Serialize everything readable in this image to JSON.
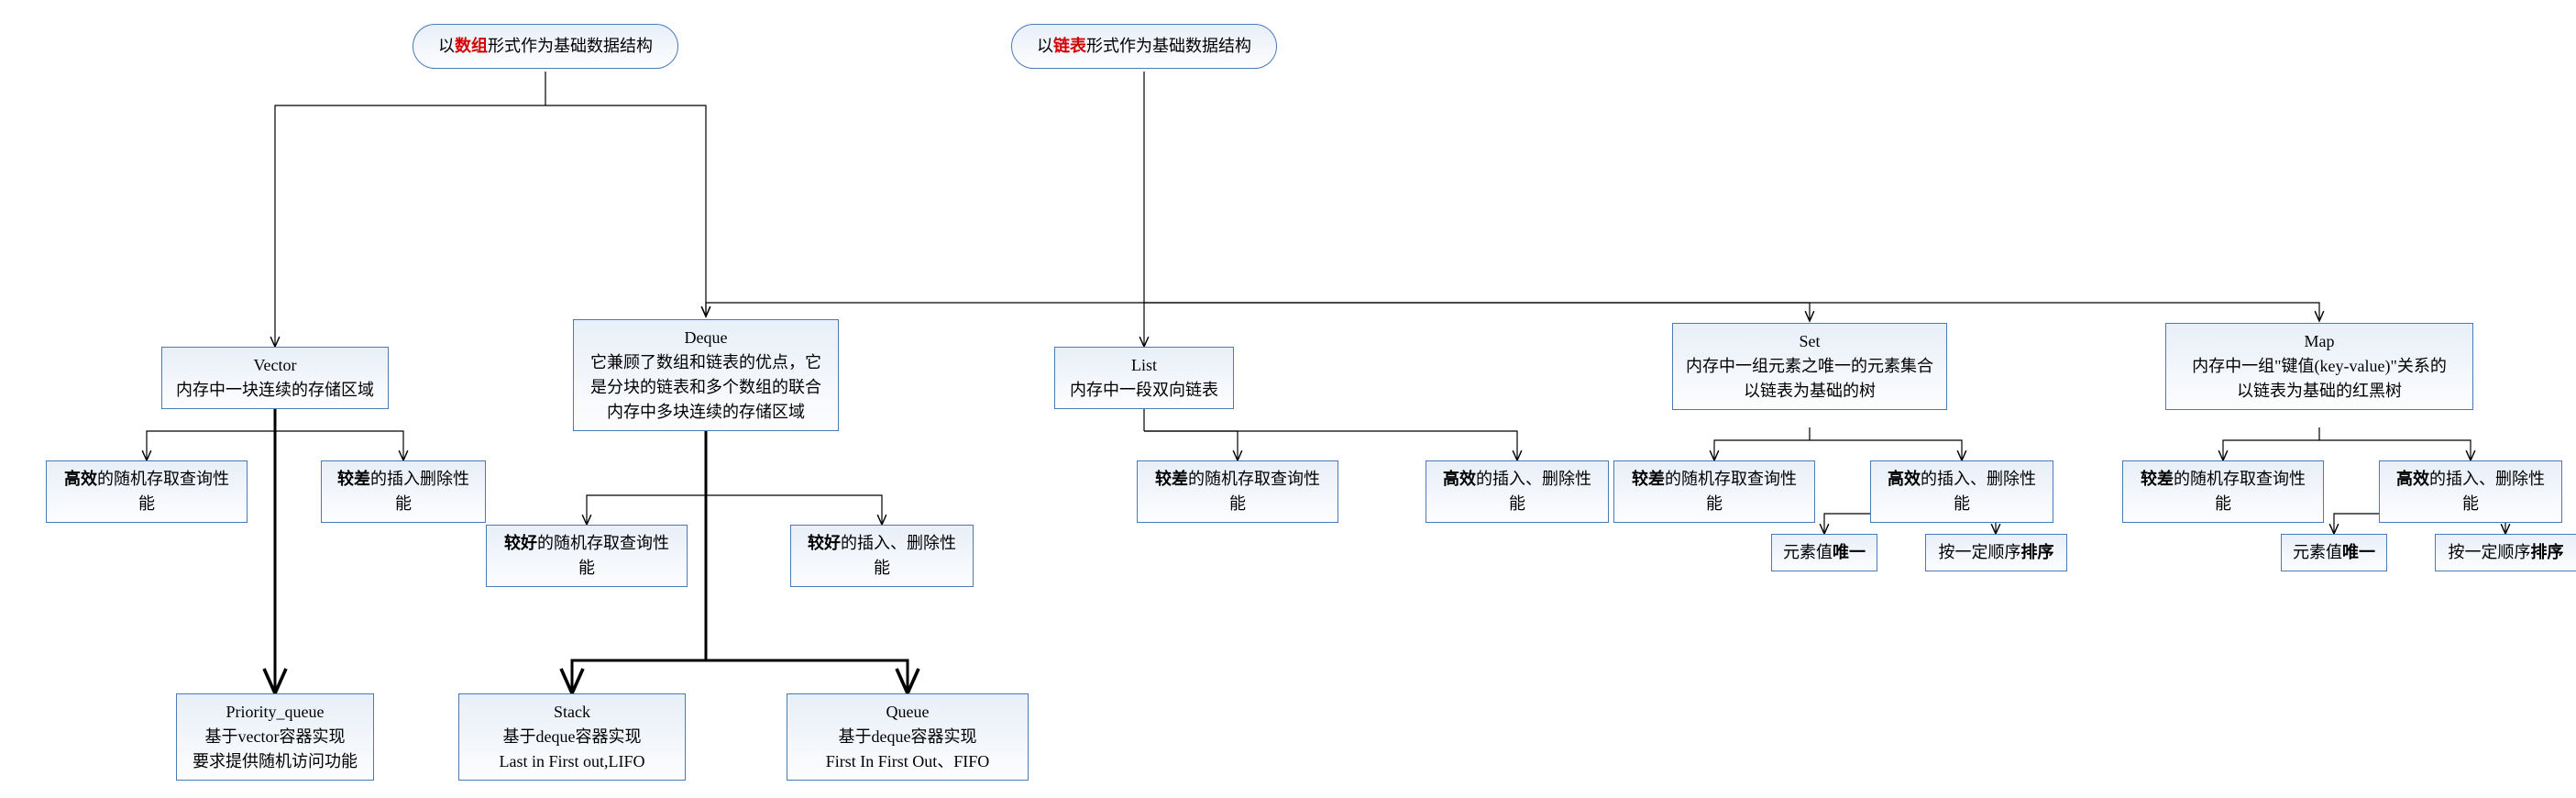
{
  "chart_data": {
    "type": "tree",
    "roots": [
      {
        "id": "root_array",
        "label": {
          "prefix": "以",
          "highlight": "数组",
          "suffix": "形式作为基础数据结构"
        },
        "children": [
          "vector",
          "deque"
        ]
      },
      {
        "id": "root_list",
        "label": {
          "prefix": "以",
          "highlight": "链表",
          "suffix": "形式作为基础数据结构"
        },
        "children": [
          "deque",
          "list",
          "set",
          "map"
        ]
      }
    ],
    "nodes": {
      "vector": {
        "title": "Vector",
        "subtitle": "内存中一块连续的存储区域",
        "children": [
          "vector_query",
          "vector_insert",
          "priority_queue"
        ]
      },
      "deque": {
        "title": "Deque",
        "subtitle": "它兼顾了数组和链表的优点，它是分块的链表和多个数组的联合\n内存中多块连续的存储区域",
        "children": [
          "deque_query",
          "deque_insert",
          "stack",
          "queue"
        ]
      },
      "list": {
        "title": "List",
        "subtitle": "内存中一段双向链表",
        "children": [
          "list_query",
          "list_insert"
        ]
      },
      "set": {
        "title": "Set",
        "subtitle": "内存中一组元素之唯一的元素集合\n以链表为基础的树",
        "children": [
          "set_query",
          "set_insert",
          "set_unique",
          "set_sort"
        ]
      },
      "map": {
        "title": "Map",
        "subtitle": "内存中一组\"键值(key-value)\"关系的\n以链表为基础的红黑树",
        "children": [
          "map_query",
          "map_insert",
          "map_unique",
          "map_sort"
        ]
      },
      "vector_query": {
        "strong": "高效",
        "rest": "的随机存取查询性能"
      },
      "vector_insert": {
        "strong": "较差",
        "rest": "的插入删除性能"
      },
      "deque_query": {
        "strong": "较好",
        "rest": "的随机存取查询性能"
      },
      "deque_insert": {
        "strong": "较好",
        "rest": "的插入、删除性能"
      },
      "list_query": {
        "strong": "较差",
        "rest": "的随机存取查询性能"
      },
      "list_insert": {
        "strong": "高效",
        "rest": "的插入、删除性能"
      },
      "set_query": {
        "strong": "较差",
        "rest": "的随机存取查询性能"
      },
      "set_insert": {
        "strong": "高效",
        "rest": "的插入、删除性能"
      },
      "set_unique": {
        "pre": "元素值",
        "strong": "唯一"
      },
      "set_sort": {
        "pre": "按一定顺序",
        "strong": "排序"
      },
      "map_query": {
        "strong": "较差",
        "rest": "的随机存取查询性能"
      },
      "map_insert": {
        "strong": "高效",
        "rest": "的插入、删除性能"
      },
      "map_unique": {
        "pre": "元素值",
        "strong": "唯一"
      },
      "map_sort": {
        "pre": "按一定顺序",
        "strong": "排序"
      },
      "priority_queue": {
        "title": "Priority_queue",
        "subtitle": "基于vector容器实现\n要求提供随机访问功能"
      },
      "stack": {
        "title": "Stack",
        "subtitle": "基于deque容器实现\nLast in First out,LIFO"
      },
      "queue": {
        "title": "Queue",
        "subtitle": "基于deque容器实现\nFirst In First Out、FIFO"
      }
    }
  },
  "root_array_prefix": "以",
  "root_array_hl": "数组",
  "root_array_suffix": "形式作为基础数据结构",
  "root_list_prefix": "以",
  "root_list_hl": "链表",
  "root_list_suffix": "形式作为基础数据结构",
  "vector_title": "Vector",
  "vector_sub": "内存中一块连续的存储区域",
  "deque_title": "Deque",
  "deque_sub1": "它兼顾了数组和链表的优点，它",
  "deque_sub2": "是分块的链表和多个数组的联合",
  "deque_sub3": "内存中多块连续的存储区域",
  "list_title": "List",
  "list_sub": "内存中一段双向链表",
  "set_title": "Set",
  "set_sub1": "内存中一组元素之唯一的元素集合",
  "set_sub2": "以链表为基础的树",
  "map_title": "Map",
  "map_sub1": "内存中一组\"键值(key-value)\"关系的",
  "map_sub2": "以链表为基础的红黑树",
  "vector_query_s": "高效",
  "vector_query_r": "的随机存取查询性能",
  "vector_insert_s": "较差",
  "vector_insert_r": "的插入删除性能",
  "deque_query_s": "较好",
  "deque_query_r": "的随机存取查询性能",
  "deque_insert_s": "较好",
  "deque_insert_r": "的插入、删除性能",
  "list_query_s": "较差",
  "list_query_r": "的随机存取查询性能",
  "list_insert_s": "高效",
  "list_insert_r": "的插入、删除性能",
  "set_query_s": "较差",
  "set_query_r": "的随机存取查询性能",
  "set_insert_s": "高效",
  "set_insert_r": "的插入、删除性能",
  "set_unique_p": "元素值",
  "set_unique_s": "唯一",
  "set_sort_p": "按一定顺序",
  "set_sort_s": "排序",
  "map_query_s": "较差",
  "map_query_r": "的随机存取查询性能",
  "map_insert_s": "高效",
  "map_insert_r": "的插入、删除性能",
  "map_unique_p": "元素值",
  "map_unique_s": "唯一",
  "map_sort_p": "按一定顺序",
  "map_sort_s": "排序",
  "pq_title": "Priority_queue",
  "pq_sub1": "基于vector容器实现",
  "pq_sub2": "要求提供随机访问功能",
  "stack_title": "Stack",
  "stack_sub1": "基于deque容器实现",
  "stack_sub2": "Last in First out,LIFO",
  "queue_title": "Queue",
  "queue_sub1": "基于deque容器实现",
  "queue_sub2": "First In First Out、FIFO"
}
